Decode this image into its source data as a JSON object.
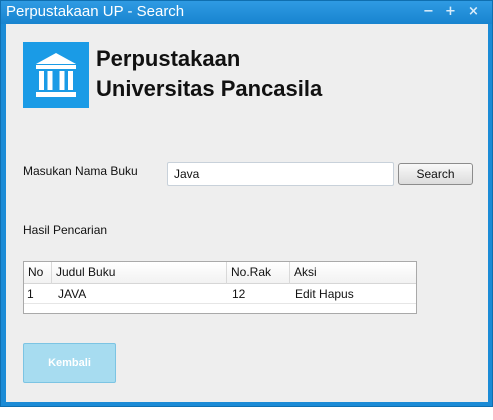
{
  "window": {
    "title": "Perpustakaan UP - Search",
    "minimize_symbol": "−",
    "maximize_symbol": "+",
    "close_symbol": "×"
  },
  "header": {
    "line1": "Perpustakaan",
    "line2": "Universitas Pancasila",
    "logo_icon": "library-building-icon"
  },
  "search": {
    "label": "Masukan Nama Buku",
    "value": "Java",
    "button_label": "Search"
  },
  "results": {
    "label": "Hasil Pencarian",
    "columns": [
      "No",
      "Judul Buku",
      "No.Rak",
      "Aksi"
    ],
    "rows": [
      {
        "no": "1",
        "judul": "JAVA",
        "rak": "12",
        "edit": "Edit",
        "hapus": "Hapus"
      }
    ]
  },
  "footer": {
    "back_label": "Kembali"
  },
  "colors": {
    "titlebar": "#1884cf",
    "logo_bg": "#1a9be6",
    "back_button": "#a7dcf0"
  }
}
